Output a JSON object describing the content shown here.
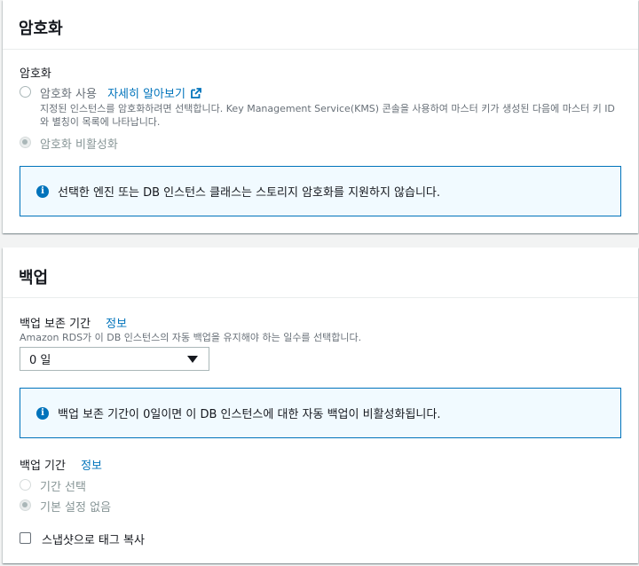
{
  "encryption": {
    "title": "암호화",
    "field_label": "암호화",
    "enable_label": "암호화 사용",
    "learn_more": "자세히 알아보기",
    "enable_description": "지정된 인스턴스를 암호화하려면 선택합니다. Key Management Service(KMS) 콘솔을 사용하여 마스터 키가 생성된 다음에 마스터 키 ID와 별칭이 목록에 나타납니다.",
    "disable_label": "암호화 비활성화",
    "alert": "선택한 엔진 또는 DB 인스턴스 클래스는 스토리지 암호화를 지원하지 않습니다."
  },
  "backup": {
    "title": "백업",
    "retention_label": "백업 보존 기간",
    "retention_info": "정보",
    "retention_description": "Amazon RDS가 이 DB 인스턴스의 자동 백업을 유지해야 하는 일수를 선택합니다.",
    "retention_value": "0 일",
    "alert": "백업 보존 기간이 0일이면 이 DB 인스턴스에 대한 자동 백업이 비활성화됩니다.",
    "window_label": "백업 기간",
    "window_info": "정보",
    "window_select_label": "기간 선택",
    "window_none_label": "기본 설정 없음",
    "copy_tags_label": "스냅샷으로 태그 복사"
  }
}
